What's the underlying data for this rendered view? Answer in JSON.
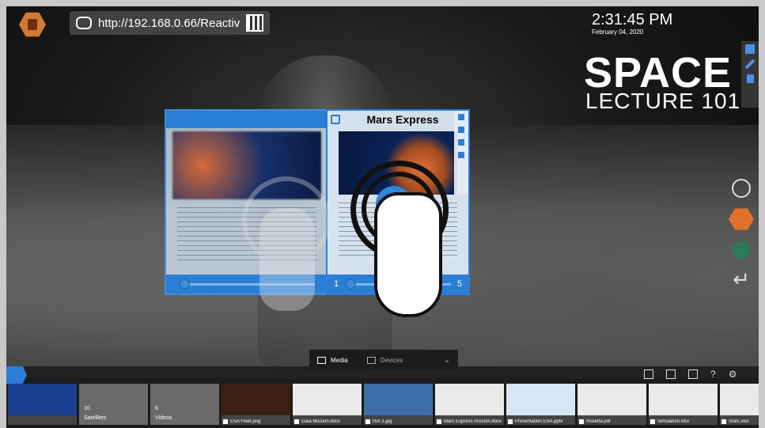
{
  "url_bar": {
    "url": "http://192.168.0.66/Reactiv"
  },
  "clock": {
    "time": "2:31:45 PM",
    "date": "February 04, 2020"
  },
  "title": {
    "line1": "SPACE",
    "line2": "LECTURE 101"
  },
  "cards": {
    "right": {
      "title": "Mars Express",
      "page_start": "1",
      "page_end": "5",
      "page_position": 0.0
    }
  },
  "bottom_tabs": {
    "media": "Media",
    "devices": "Devices"
  },
  "tray": {
    "items": [
      {
        "type": "file",
        "name": ""
      },
      {
        "type": "folder",
        "count": "10",
        "name": "Satellites"
      },
      {
        "type": "folder",
        "count": "6",
        "name": "Videos"
      },
      {
        "type": "file",
        "name": "ESA Fleet.png"
      },
      {
        "type": "file",
        "name": "Gaia Mission.docx"
      },
      {
        "type": "file",
        "name": "ISS 1.jpg"
      },
      {
        "type": "file",
        "name": "Mars Express mission.docx"
      },
      {
        "type": "file",
        "name": "Presentation ESA.pptx"
      },
      {
        "type": "file",
        "name": "Rosetta.pdf"
      },
      {
        "type": "file",
        "name": "Simulation.xlsx"
      },
      {
        "type": "file",
        "name": "Stats.xlsx"
      }
    ],
    "help": "?"
  },
  "colors": {
    "accent": "#2a7fd4",
    "logo_orange": "#e0702a",
    "logo_green": "#2b7a5a"
  }
}
